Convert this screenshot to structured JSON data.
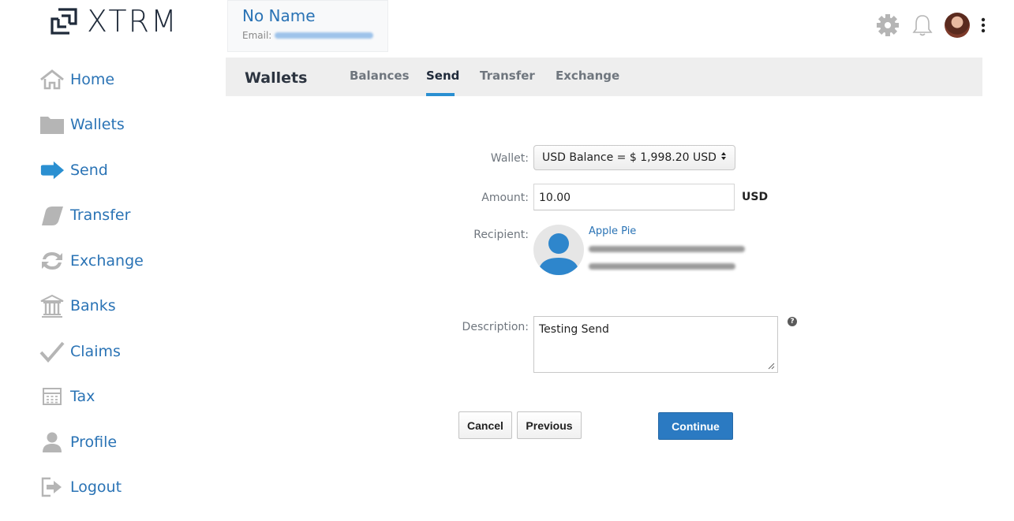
{
  "logo": {
    "text": "XTRM"
  },
  "sidebar": {
    "items": [
      {
        "label": "Home",
        "icon": "home-icon"
      },
      {
        "label": "Wallets",
        "icon": "folder-icon"
      },
      {
        "label": "Send",
        "icon": "arrow-right-icon"
      },
      {
        "label": "Transfer",
        "icon": "transfer-icon"
      },
      {
        "label": "Exchange",
        "icon": "exchange-icon"
      },
      {
        "label": "Banks",
        "icon": "bank-icon"
      },
      {
        "label": "Claims",
        "icon": "checkmark-icon"
      },
      {
        "label": "Tax",
        "icon": "calculator-icon"
      },
      {
        "label": "Profile",
        "icon": "person-icon"
      },
      {
        "label": "Logout",
        "icon": "logout-icon"
      }
    ]
  },
  "user": {
    "name": "No Name",
    "email_label": "Email:"
  },
  "topbar": {
    "icons": [
      "gear-icon",
      "bell-icon",
      "avatar",
      "more-vertical-icon"
    ]
  },
  "tabs": {
    "title": "Wallets",
    "items": [
      {
        "label": "Balances",
        "active": false
      },
      {
        "label": "Send",
        "active": true
      },
      {
        "label": "Transfer",
        "active": false
      },
      {
        "label": "Exchange",
        "active": false
      }
    ]
  },
  "form": {
    "wallet_label": "Wallet:",
    "wallet_value": "USD Balance = $ 1,998.20 USD",
    "amount_label": "Amount:",
    "amount_value": "10.00",
    "currency": "USD",
    "recipient_label": "Recipient:",
    "recipient_name": "Apple Pie",
    "description_label": "Description:",
    "description_value": "Testing Send"
  },
  "buttons": {
    "cancel": "Cancel",
    "previous": "Previous",
    "continue": "Continue"
  },
  "colors": {
    "accent": "#2a73b5",
    "primary_button": "#2b7ac2",
    "tab_underline": "#2a8fd1",
    "icon_gray": "#b5b5b5"
  }
}
